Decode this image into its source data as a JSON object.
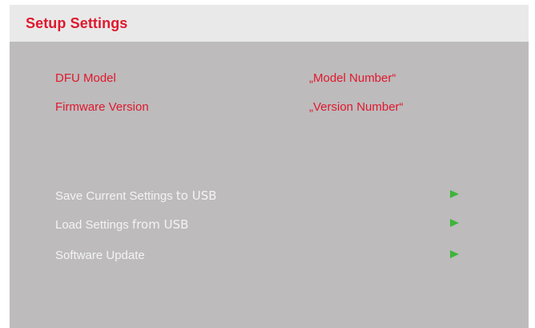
{
  "header": {
    "title": "Setup Settings"
  },
  "info": [
    {
      "label": "DFU Model",
      "value": "„Model Number“"
    },
    {
      "label": "Firmware Version",
      "value": "„Version Number“"
    }
  ],
  "menu": [
    {
      "label": "Save Current Settings",
      "suffix": "to USB",
      "icon": "play-arrow-icon"
    },
    {
      "label": "Load Settings",
      "suffix": "from USB",
      "icon": "play-arrow-icon"
    },
    {
      "label": "Software Update",
      "suffix": "",
      "icon": "play-arrow-icon"
    }
  ],
  "colors": {
    "accent": "#e0182d",
    "panel_bg": "#bdbbbc",
    "header_bg": "#e9e9e9",
    "menu_text": "#f4f4f4",
    "arrow": "#3fb43a"
  }
}
